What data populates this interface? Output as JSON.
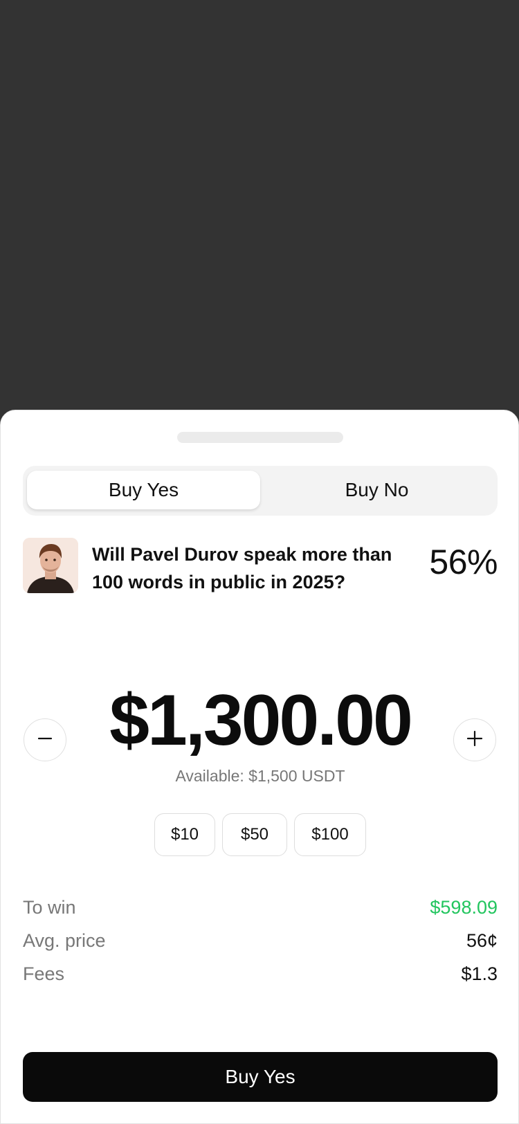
{
  "tabs": {
    "yes_label": "Buy Yes",
    "no_label": "Buy No"
  },
  "market": {
    "question": "Will Pavel Durov speak more than 100 words in public in 2025?",
    "probability": "56%"
  },
  "amount": {
    "value": "$1,300.00",
    "available": "Available: $1,500 USDT"
  },
  "quick_amounts": [
    "$10",
    "$50",
    "$100"
  ],
  "summary": {
    "to_win_label": "To win",
    "to_win_value": "$598.09",
    "avg_price_label": "Avg. price",
    "avg_price_value": "56¢",
    "fees_label": "Fees",
    "fees_value": "$1.3"
  },
  "cta": {
    "label": "Buy Yes"
  },
  "colors": {
    "backdrop": "#333333",
    "accent_green": "#22c55e",
    "cta_bg": "#0a0a0a"
  },
  "icons": [
    "minus-icon",
    "plus-icon",
    "market-avatar"
  ]
}
